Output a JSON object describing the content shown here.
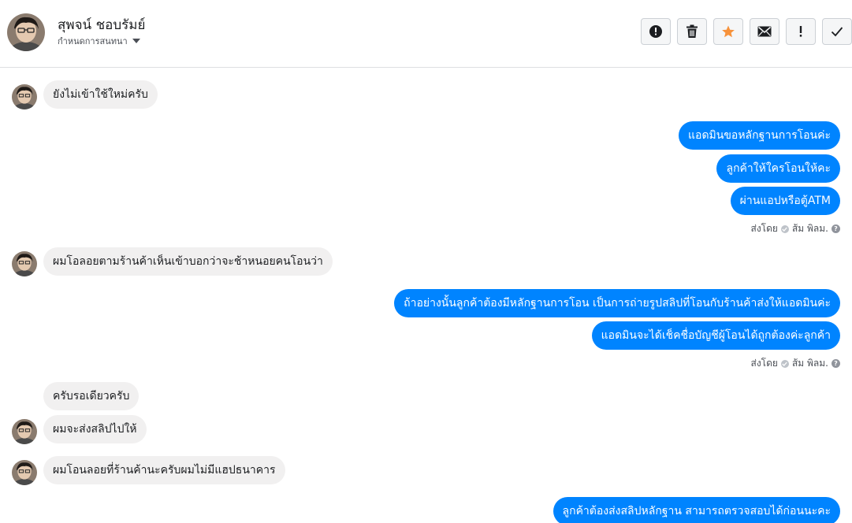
{
  "header": {
    "contact_name": "สุพจน์ ชอบรัมย์",
    "assign_label": "กำหนดการสนทนา",
    "actions": [
      {
        "icon": "alert-circle-icon",
        "name": "mark-spam-button"
      },
      {
        "icon": "trash-icon",
        "name": "delete-button"
      },
      {
        "icon": "star-icon",
        "name": "star-button"
      },
      {
        "icon": "envelope-icon",
        "name": "mark-unread-button"
      },
      {
        "icon": "exclamation-icon",
        "name": "follow-up-button"
      },
      {
        "icon": "check-icon",
        "name": "mark-done-button"
      }
    ],
    "star_color": "#f7923b"
  },
  "colors": {
    "outgoing": "#0084ff",
    "incoming": "#f1f0f0"
  },
  "messages": {
    "m1": "ยังไม่เข้าใช้ใหม่ครับ",
    "m2": "แอดมินขอหลักฐานการโอนค่ะ",
    "m3": "ลูกค้าให้ใครโอนให้คะ",
    "m4": "ผ่านแอปหรือตู้ATM",
    "m5": "ผมโอลอยตามร้านค้าเห็นเข้าบอกว่าจะช้าหนอยคนโอนว่า",
    "m6": "ถ้าอย่างนั้นลูกค้าต้องมีหลักฐานการโอน เป็นการถ่ายรูปสลิปที่โอนกับร้านค้าส่งให้แอดมินค่ะ",
    "m7": "แอดมินจะได้เช็คชื่อบัญชีผู้โอนได้ถูกต้องค่ะลูกค้า",
    "m8": "ครับรอเดียวครับ",
    "m9": "ผมจะส่งสลิปไปให้",
    "m10": "ผมโอนลอยที่ร้านค้านะครับผมไม่มีแฮปธนาคาร",
    "m11": "ลูกค้าต้องส่งสลิปหลักฐาน สามารถตรวจสอบได้ก่อนนะคะ"
  },
  "status": {
    "sent_by_label": "ส่งโดย",
    "sender": "ส้ม พิลม."
  }
}
